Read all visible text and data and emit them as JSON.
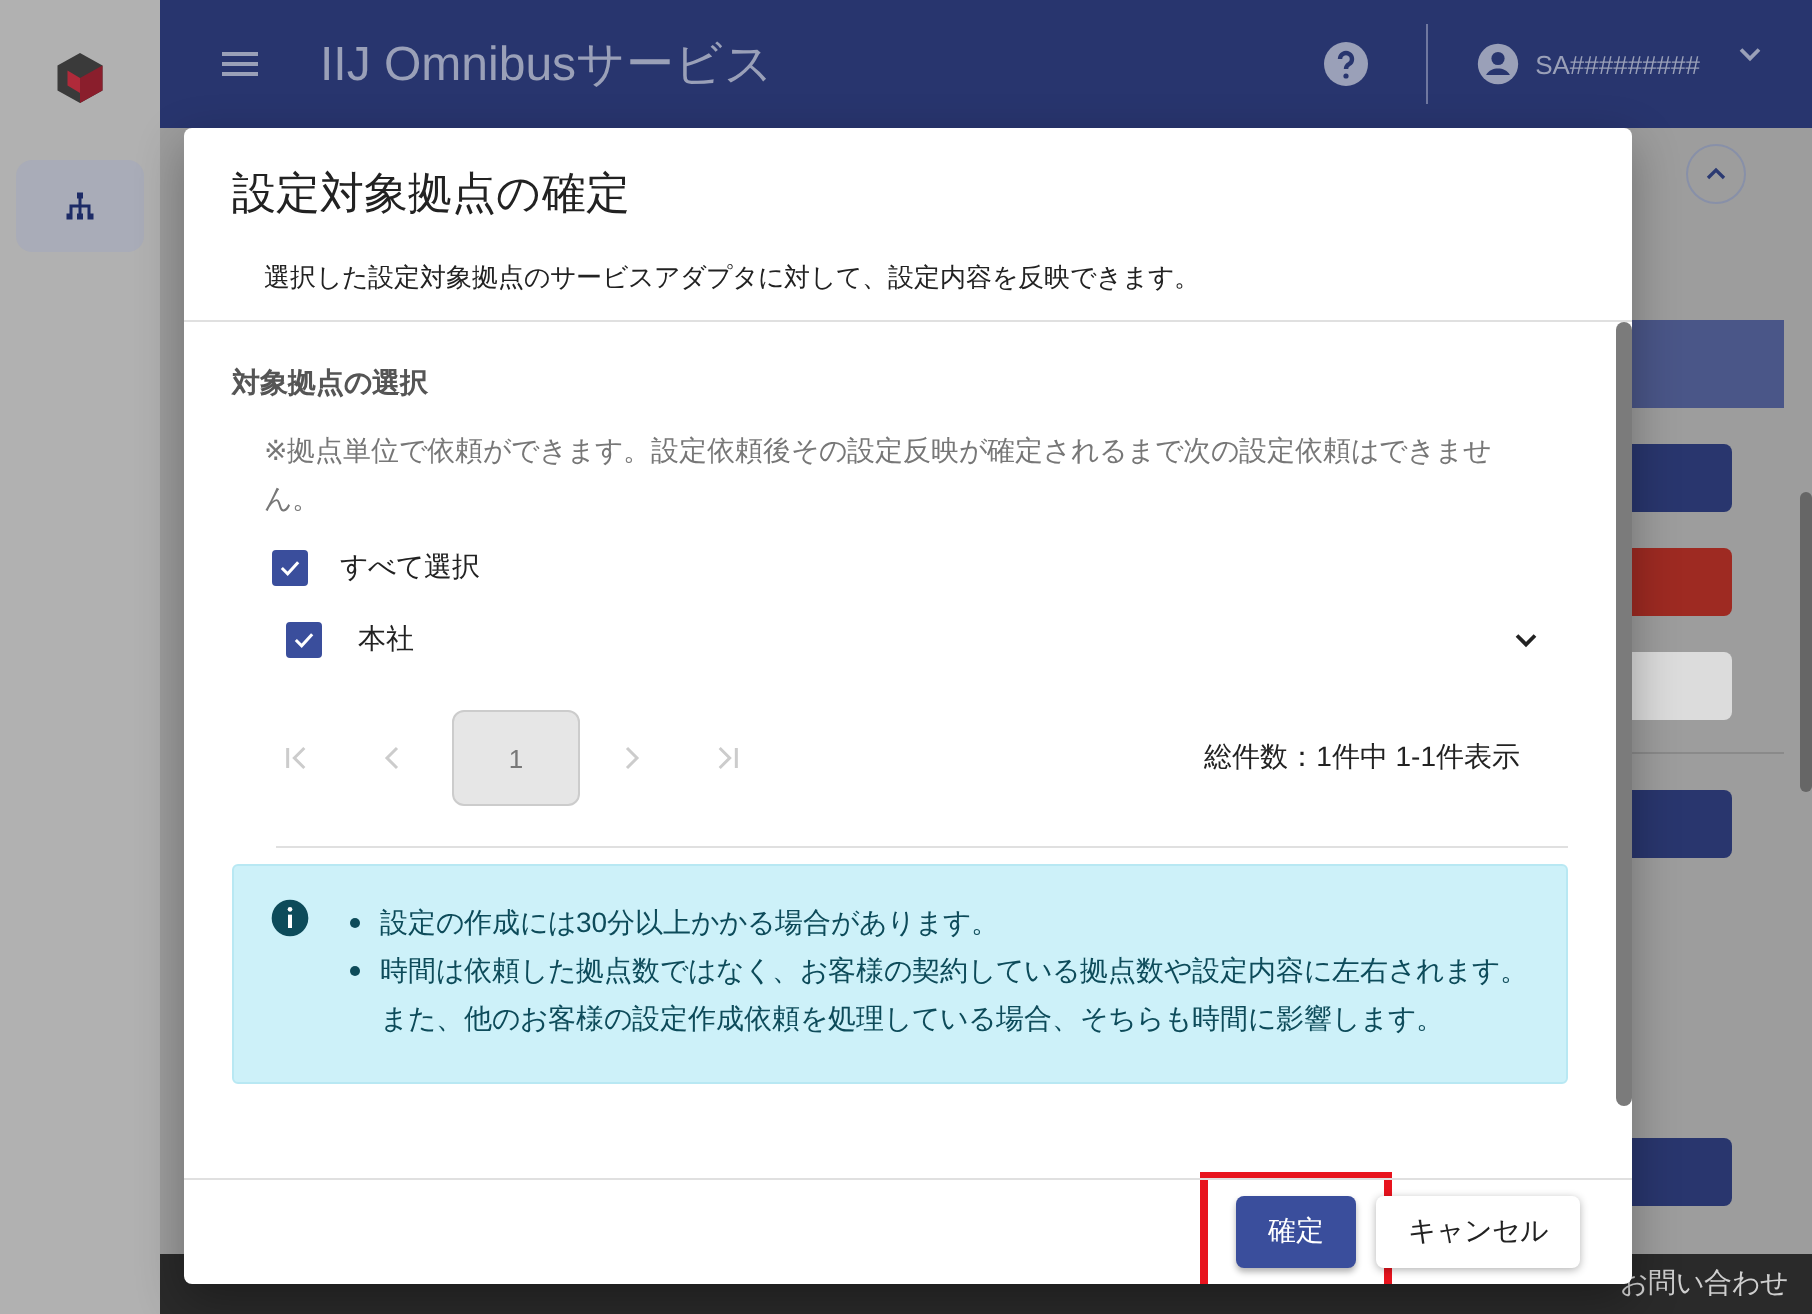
{
  "header": {
    "title": "IIJ Omnibusサービス",
    "user": "SA#########"
  },
  "dialog": {
    "title": "設定対象拠点の確定",
    "description": "選択した設定対象拠点のサービスアダプタに対して、設定内容を反映できます。",
    "section_title": "対象拠点の選択",
    "note": "※拠点単位で依頼ができます。設定依頼後その設定反映が確定されるまで次の設定依頼はできません。",
    "select_all": {
      "label": "すべて選択",
      "checked": true
    },
    "sites": [
      {
        "name": "本社",
        "checked": true,
        "expanded": false
      }
    ],
    "pagination": {
      "nav_before": [
        {
          "kind": "first",
          "disabled": true
        },
        {
          "kind": "prev",
          "disabled": true
        }
      ],
      "pages": [
        {
          "label": "1",
          "selected": true
        }
      ],
      "nav_after": [
        {
          "kind": "next",
          "disabled": true
        },
        {
          "kind": "last",
          "disabled": true
        }
      ],
      "summary": "総件数：1件中 1-1件表示"
    },
    "info": [
      {
        "text": "設定の作成には30分以上かかる場合があります。",
        "bullet": true
      },
      {
        "text": "時間は依頼した拠点数ではなく、お客様の契約している拠点数や設定内容に左右されます。",
        "bullet": true
      },
      {
        "text": "また、他のお客様の設定作成依頼を処理している場合、そちらも時間に影響します。",
        "bullet": false
      }
    ],
    "buttons": [
      {
        "label": "確定",
        "kind": "primary",
        "highlighted": true
      },
      {
        "label": "キャンセル",
        "kind": "secondary",
        "highlighted": false
      }
    ]
  },
  "footer": {
    "links": [
      "お問い合わせ"
    ]
  }
}
